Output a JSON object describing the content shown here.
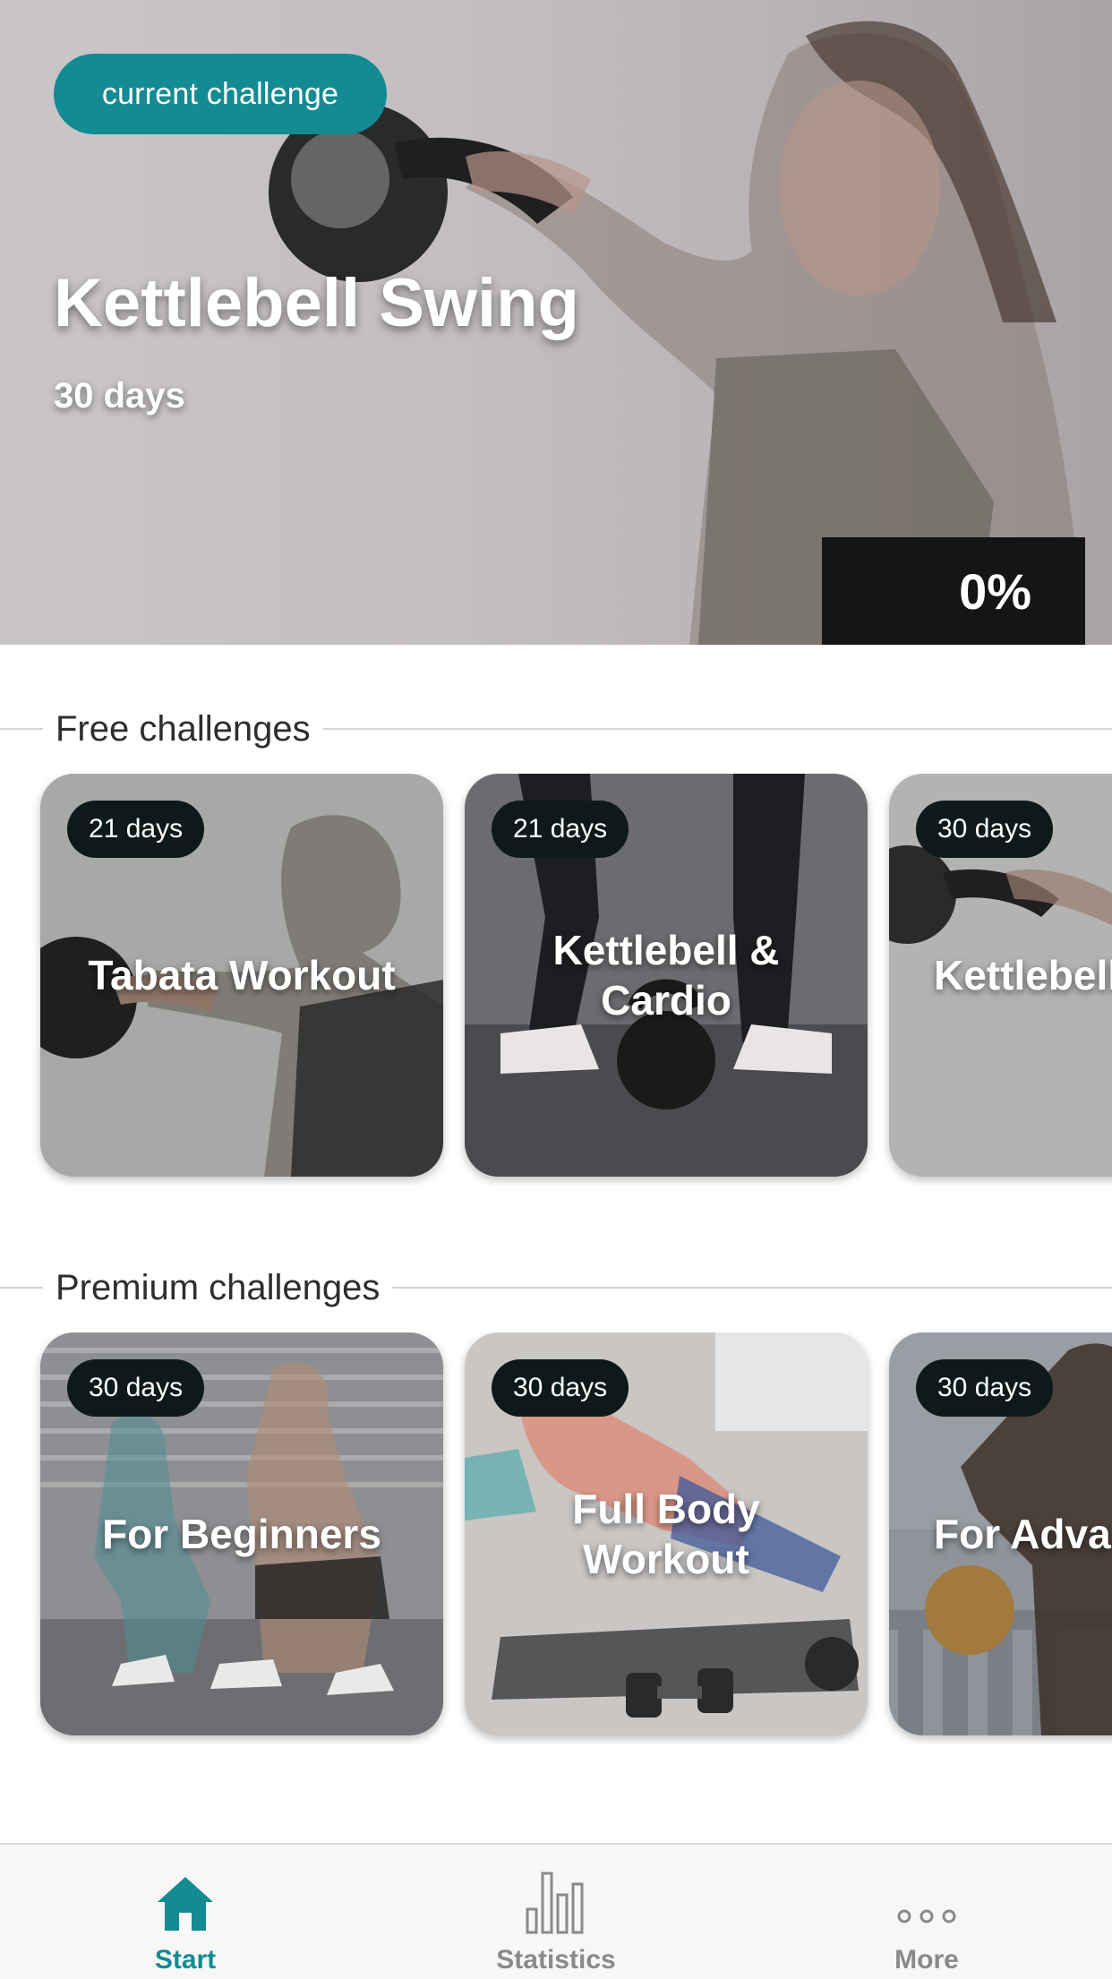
{
  "hero": {
    "badge": "current challenge",
    "title": "Kettlebell Swing",
    "subtitle": "30 days",
    "progress_text": "0%",
    "progress_value": 0
  },
  "free_section": {
    "heading": "Free challenges",
    "cards": [
      {
        "days": "21 days",
        "title": "Tabata Workout"
      },
      {
        "days": "21 days",
        "title": "Kettlebell &\nCardio"
      },
      {
        "days": "30 days",
        "title": "Kettlebell"
      }
    ]
  },
  "premium_section": {
    "heading": "Premium challenges",
    "cards": [
      {
        "days": "30 days",
        "title": "For Beginners"
      },
      {
        "days": "30 days",
        "title": "Full Body\nWorkout"
      },
      {
        "days": "30 days",
        "title": "For Adva"
      }
    ]
  },
  "nav": {
    "items": [
      {
        "label": "Start",
        "icon": "home-icon",
        "active": true
      },
      {
        "label": "Statistics",
        "icon": "bar-chart-icon",
        "active": false
      },
      {
        "label": "More",
        "icon": "more-dots-icon",
        "active": false
      }
    ]
  },
  "colors": {
    "accent": "#138b92",
    "badge_dark": "#0e1a1a",
    "nav_inactive": "#8a8a8a"
  }
}
